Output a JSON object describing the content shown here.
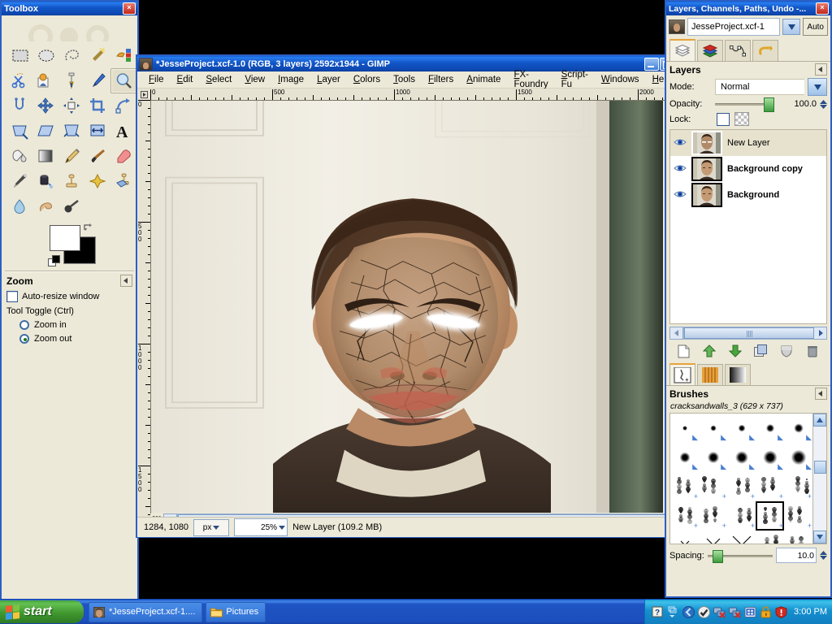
{
  "desktop": {
    "background_color": "#000000"
  },
  "toolbox": {
    "title": "Toolbox",
    "close_label": "×",
    "tools": [
      {
        "name": "rect-select-tool",
        "label": "Rectangle Select"
      },
      {
        "name": "ellipse-select-tool",
        "label": "Ellipse Select"
      },
      {
        "name": "free-select-tool",
        "label": "Free Select"
      },
      {
        "name": "fuzzy-select-tool",
        "label": "Fuzzy Select"
      },
      {
        "name": "select-by-color-tool",
        "label": "Select by Color"
      },
      {
        "name": "scissors-select-tool",
        "label": "Scissors Select"
      },
      {
        "name": "foreground-select-tool",
        "label": "Foreground Select"
      },
      {
        "name": "paths-tool",
        "label": "Paths"
      },
      {
        "name": "color-picker-tool",
        "label": "Color Picker"
      },
      {
        "name": "zoom-tool",
        "label": "Zoom"
      },
      {
        "name": "measure-tool",
        "label": "Measure"
      },
      {
        "name": "move-tool",
        "label": "Move"
      },
      {
        "name": "alignment-tool",
        "label": "Alignment"
      },
      {
        "name": "crop-tool",
        "label": "Crop"
      },
      {
        "name": "rotate-tool",
        "label": "Rotate"
      },
      {
        "name": "scale-tool",
        "label": "Scale"
      },
      {
        "name": "shear-tool",
        "label": "Shear"
      },
      {
        "name": "perspective-tool",
        "label": "Perspective"
      },
      {
        "name": "flip-tool",
        "label": "Flip"
      },
      {
        "name": "text-tool",
        "label": "Text"
      },
      {
        "name": "bucket-fill-tool",
        "label": "Bucket Fill"
      },
      {
        "name": "gradient-tool",
        "label": "Blend"
      },
      {
        "name": "pencil-tool",
        "label": "Pencil"
      },
      {
        "name": "paintbrush-tool",
        "label": "Paintbrush"
      },
      {
        "name": "eraser-tool",
        "label": "Eraser"
      },
      {
        "name": "airbrush-tool",
        "label": "Airbrush"
      },
      {
        "name": "ink-tool",
        "label": "Ink"
      },
      {
        "name": "clone-tool",
        "label": "Clone"
      },
      {
        "name": "heal-tool",
        "label": "Heal"
      },
      {
        "name": "perspective-clone-tool",
        "label": "Perspective Clone"
      },
      {
        "name": "blur-sharpen-tool",
        "label": "Blur / Sharpen"
      },
      {
        "name": "smudge-tool",
        "label": "Smudge"
      },
      {
        "name": "dodge-burn-tool",
        "label": "Dodge / Burn"
      }
    ],
    "selected_tool_index": 9,
    "colors": {
      "foreground": "#ffffff",
      "background": "#000000"
    },
    "tool_options": {
      "title": "Zoom",
      "auto_resize_label": "Auto-resize window",
      "auto_resize_checked": false,
      "tool_toggle_label": "Tool Toggle  (Ctrl)",
      "options": [
        {
          "label": "Zoom in",
          "selected": false
        },
        {
          "label": "Zoom out",
          "selected": true
        }
      ]
    }
  },
  "image_window": {
    "title": "*JesseProject.xcf-1.0 (RGB, 3 layers) 2592x1944 - GIMP",
    "menu": [
      "File",
      "Edit",
      "Select",
      "View",
      "Image",
      "Layer",
      "Colors",
      "Tools",
      "Filters",
      "Animate",
      "FX-Foundry",
      "Script-Fu",
      "Windows",
      "Help"
    ],
    "ruler_h_labels": [
      "0",
      "500",
      "1000",
      "1500",
      "2000"
    ],
    "ruler_v_labels": [
      "0",
      "500",
      "1000",
      "1500"
    ],
    "status": {
      "position": "1284, 1080",
      "unit": "px",
      "zoom": "25%",
      "layer_info": "New Layer (109.2 MB)"
    }
  },
  "dock": {
    "title": "Layers, Channels, Paths, Undo -...",
    "close_label": "×",
    "image_name": "JesseProject.xcf-1",
    "auto_label": "Auto",
    "tabs": [
      {
        "name": "tab-layers",
        "label": "Layers"
      },
      {
        "name": "tab-channels",
        "label": "Channels"
      },
      {
        "name": "tab-paths",
        "label": "Paths"
      },
      {
        "name": "tab-undo",
        "label": "Undo History"
      }
    ],
    "active_tab_index": 0,
    "layers_panel": {
      "title": "Layers",
      "mode_label": "Mode:",
      "mode_value": "Normal",
      "opacity_label": "Opacity:",
      "opacity_value": "100.0",
      "lock_label": "Lock:",
      "layers": [
        {
          "name": "New Layer",
          "visible": true,
          "selected": true,
          "bold": false
        },
        {
          "name": "Background copy",
          "visible": true,
          "selected": false,
          "bold": true
        },
        {
          "name": "Background",
          "visible": true,
          "selected": false,
          "bold": true
        }
      ],
      "buttons": [
        {
          "name": "new-layer-button",
          "label": "New Layer"
        },
        {
          "name": "raise-layer-button",
          "label": "Raise Layer"
        },
        {
          "name": "lower-layer-button",
          "label": "Lower Layer"
        },
        {
          "name": "duplicate-layer-button",
          "label": "Duplicate Layer"
        },
        {
          "name": "anchor-layer-button",
          "label": "Anchor Layer"
        },
        {
          "name": "delete-layer-button",
          "label": "Delete Layer"
        }
      ]
    },
    "brushes_panel": {
      "title": "Brushes",
      "selected_brush": "cracksandwalls_3 (629 x 737)",
      "spacing_label": "Spacing:",
      "spacing_value": "10.0",
      "tabs": [
        {
          "name": "tab-brushes",
          "label": "Brushes"
        },
        {
          "name": "tab-patterns",
          "label": "Patterns"
        },
        {
          "name": "tab-gradients",
          "label": "Gradients"
        }
      ],
      "active_tab_index": 0,
      "selected_cell_index": 18
    }
  },
  "taskbar": {
    "start_label": "start",
    "tasks": [
      {
        "name": "taskbar-item-gimp",
        "label": "*JesseProject.xcf-1....",
        "icon": "gimp-image-icon"
      },
      {
        "name": "taskbar-item-pictures",
        "label": "Pictures",
        "icon": "folder-icon"
      }
    ],
    "tray_icons": [
      "help-icon",
      "network-icon",
      "shield-check-icon",
      "network-disconnected-icon",
      "network-disconnected-2-icon",
      "windows-update-icon",
      "lock-warning-icon",
      "security-alert-icon"
    ],
    "clock": "3:00 PM"
  }
}
